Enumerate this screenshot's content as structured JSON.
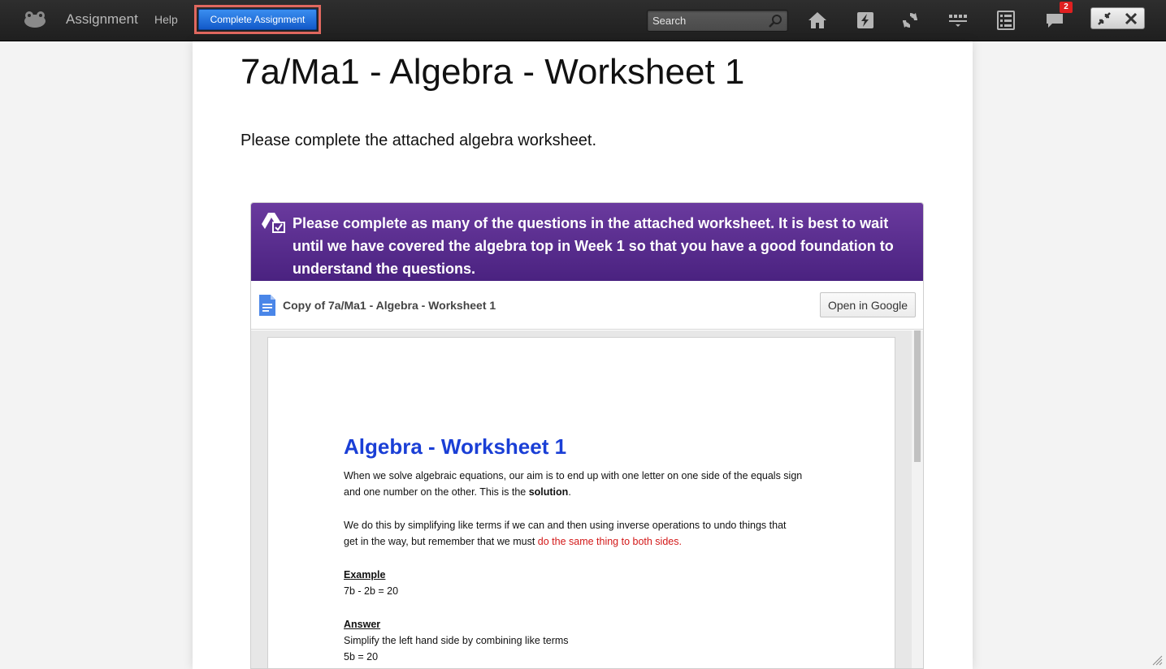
{
  "topbar": {
    "app_title": "Assignment",
    "help_label": "Help",
    "complete_label": "Complete Assignment",
    "search_placeholder": "Search",
    "notification_count": "2",
    "icons": [
      "frog-logo-icon",
      "home-icon",
      "lightning-icon",
      "sync-icon",
      "grid-menu-icon",
      "checklist-icon",
      "chat-icon",
      "collapse-icon",
      "close-icon"
    ]
  },
  "page": {
    "title": "7a/Ma1 - Algebra - Worksheet 1",
    "description": "Please complete the attached algebra worksheet."
  },
  "card": {
    "header_text": "Please complete as many of the questions in the attached worksheet. It is best to wait until we have covered the algebra top in Week 1 so that you have a good foundation to understand the questions.",
    "doc_name": "Copy of 7a/Ma1 - Algebra - Worksheet 1",
    "open_label": "Open in Google",
    "header_color": "#5a2d8f"
  },
  "worksheet": {
    "title": "Algebra - Worksheet 1",
    "p1_line1": "When we solve algebraic equations, our aim is to end up with one letter on one side of the equals sign",
    "p1_line2_pre": "and one number on the other.  This is the ",
    "p1_line2_bold": "solution",
    "p1_line2_post": ".",
    "p2_line1": "We do this by simplifying like terms if we can and then using inverse operations to undo things that",
    "p2_line2_pre": "get in the way, but remember that we must ",
    "p2_line2_red": "do the same thing to both sides",
    "p2_line2_post": ".",
    "example_heading": "Example",
    "example_eq": "7b - 2b = 20",
    "answer_heading": "Answer",
    "answer_line1": "Simplify the left hand side by combining like terms",
    "answer_line2": "5b = 20"
  }
}
